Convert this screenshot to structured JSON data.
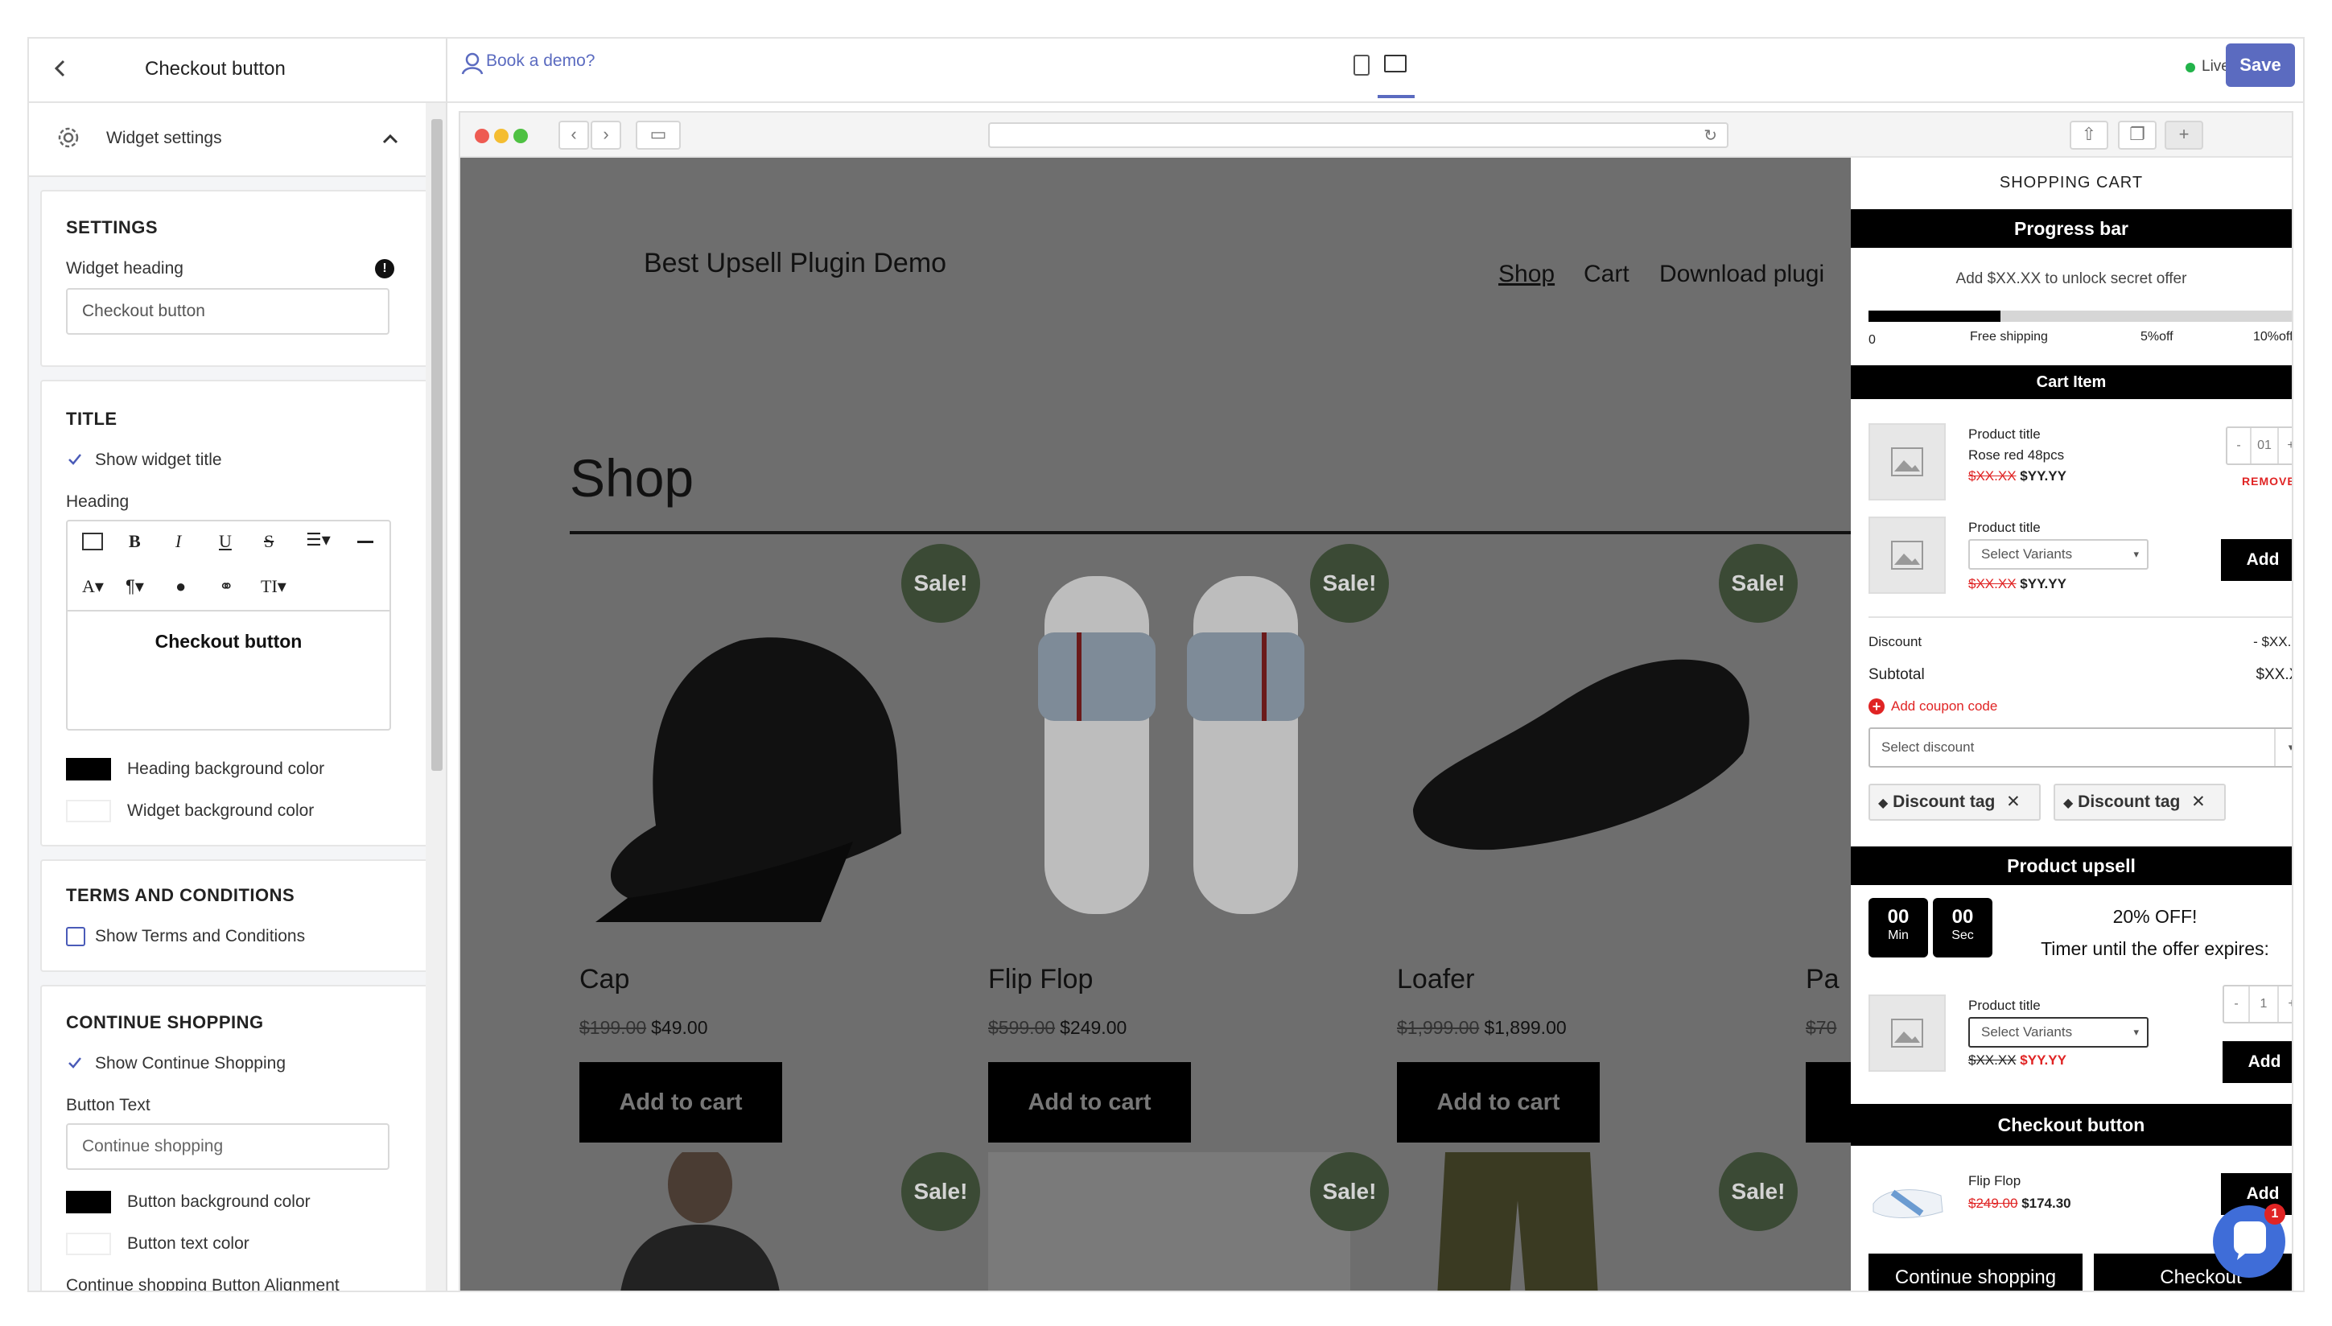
{
  "editor": {
    "back_label": "<",
    "panel_title": "Checkout button",
    "widget_settings_label": "Widget settings",
    "settings": {
      "title": "SETTINGS",
      "widget_heading_label": "Widget heading",
      "widget_heading_value": "Checkout button"
    },
    "title_section": {
      "title": "TITLE",
      "show_widget_title_label": "Show widget title",
      "show_widget_title_checked": true,
      "heading_label": "Heading",
      "toolbar_row1": [
        "image",
        "B",
        "I",
        "U",
        "S",
        "align",
        "rule"
      ],
      "toolbar_row2": [
        "A",
        "¶",
        "drop",
        "link",
        "T"
      ],
      "heading_value": "Checkout button",
      "heading_bg_label": "Heading background color",
      "heading_bg_color": "#000000",
      "widget_bg_label": "Widget background color",
      "widget_bg_color": "#ffffff"
    },
    "terms": {
      "title": "TERMS AND CONDITIONS",
      "show_terms_label": "Show Terms and Conditions",
      "show_terms_checked": false
    },
    "continue": {
      "title": "CONTINUE SHOPPING",
      "show_continue_label": "Show Continue Shopping",
      "show_continue_checked": true,
      "button_text_label": "Button Text",
      "button_text_placeholder": "Continue shopping",
      "button_bg_label": "Button background color",
      "button_bg_color": "#000000",
      "button_text_color_label": "Button text color",
      "button_text_color": "#ffffff",
      "alignment_label": "Continue shopping Button Alignment"
    }
  },
  "topbar": {
    "demo_label": "Book a demo?",
    "live_label": "Live",
    "save_label": "Save",
    "accent_color": "#5b6bc0"
  },
  "shop": {
    "site_title": "Best Upsell Plugin Demo",
    "nav": [
      "Shop",
      "Cart",
      "Download plugi"
    ],
    "page_heading": "Shop",
    "sale_label": "Sale!",
    "add_to_cart_label": "Add to cart",
    "products": [
      {
        "name": "Cap",
        "old_price": "$199.00",
        "price": "$49.00"
      },
      {
        "name": "Flip Flop",
        "old_price": "$599.00",
        "price": "$249.00"
      },
      {
        "name": "Loafer",
        "old_price": "$1,999.00",
        "price": "$1,899.00"
      },
      {
        "name": "Pa",
        "old_price": "$70",
        "price": ""
      }
    ]
  },
  "cart": {
    "title": "SHOPPING CART",
    "progress": {
      "bar_title": "Progress bar",
      "message": "Add $XX.XX to unlock secret offer",
      "fill_fraction": 0.3,
      "labels": [
        "0",
        "Free shipping",
        "5%off",
        "10%off"
      ]
    },
    "cart_item": {
      "bar_title": "Cart Item",
      "item1": {
        "title": "Product title",
        "variant": "Rose red 48pcs",
        "old_price": "$XX.XX",
        "price": "$YY.YY",
        "qty": "01",
        "remove_label": "REMOVE"
      },
      "item2": {
        "title": "Product title",
        "select_label": "Select Variants",
        "old_price": "$XX.XX",
        "price": "$YY.YY",
        "add_label": "Add"
      },
      "discount_label": "Discount",
      "discount_value": "- $XX.XX",
      "subtotal_label": "Subtotal",
      "subtotal_value": "$XX.XX",
      "coupon_label": "Add coupon code",
      "select_discount_label": "Select discount",
      "tags": [
        "Discount tag",
        "Discount tag"
      ]
    },
    "upsell": {
      "bar_title": "Product upsell",
      "timer_min": "00",
      "timer_min_label": "Min",
      "timer_sec": "00",
      "timer_sec_label": "Sec",
      "offer": "20% OFF!",
      "offer_sub": "Timer until the offer expires:",
      "item": {
        "title": "Product title",
        "select_label": "Select Variants",
        "old_price": "$XX.XX",
        "price": "$YY.YY",
        "qty": "1",
        "add_label": "Add"
      }
    },
    "checkout": {
      "bar_title": "Checkout button",
      "item": {
        "title": "Flip Flop",
        "old_price": "$249.00",
        "price": "$174.30",
        "add_label": "Add"
      },
      "continue_label": "Continue shopping",
      "checkout_label": "Checkout"
    }
  },
  "chat": {
    "badge": "1"
  }
}
